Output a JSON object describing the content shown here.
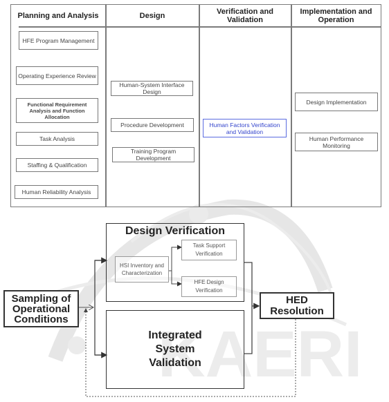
{
  "table": {
    "columns": [
      {
        "header": "Planning and Analysis",
        "items": [
          "HFE Program Management",
          "Operating Experience Review",
          "Functional Requirement Analysis and Function Allocation",
          "Task Analysis",
          "Staffing & Qualification",
          "Human Reliability Analysis"
        ]
      },
      {
        "header": "Design",
        "items": [
          "Human-System Interface Design",
          "Procedure Development",
          "Training Program Development"
        ]
      },
      {
        "header": "Verification and Validation",
        "items": [
          "Human Factors Verification and Validation"
        ]
      },
      {
        "header": "Implementation and Operation",
        "items": [
          "Design Implementation",
          "Human Performance Monitoring"
        ]
      }
    ]
  },
  "flow": {
    "sampling": "Sampling of Operational Conditions",
    "design_verification": {
      "title": "Design Verification",
      "hsi": "HSI Inventory and Characterization",
      "task_support": "Task Support Verification",
      "hfe_design": "HFE Design Verification"
    },
    "isv": "Integrated System Validation",
    "hed": "HED Resolution"
  },
  "watermark": "KAERI",
  "colors": {
    "highlight_blue": "#3344cc",
    "line": "#333333"
  }
}
